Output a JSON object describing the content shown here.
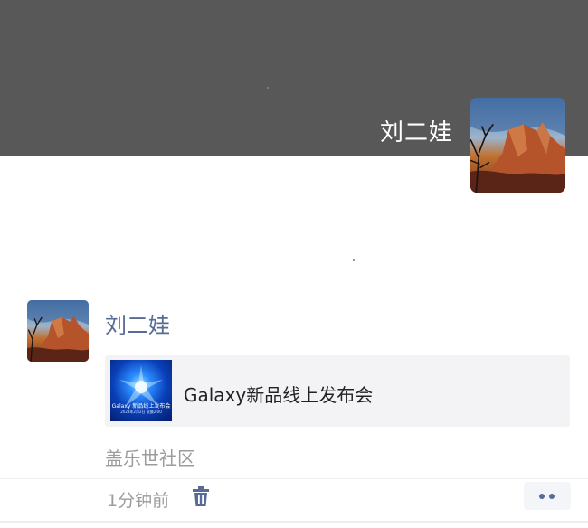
{
  "profile": {
    "name": "刘二娃",
    "cover_color": "#585858",
    "avatar_icon": "red-rock-canyon-photo"
  },
  "post": {
    "author": "刘二娃",
    "link": {
      "title": "Galaxy新品线上发布会",
      "thumbnail_title": "Galaxy 新品线上发布会",
      "thumbnail_subtitle": "2023年2月2日 凌晨2:00"
    },
    "source": "盖乐世社区",
    "time": "1分钟前",
    "delete_icon": "trash-icon",
    "more_icon": "more-icon"
  },
  "colors": {
    "author_link": "#576b95",
    "secondary_text": "#9c9c9c",
    "card_bg": "#f3f3f5"
  }
}
